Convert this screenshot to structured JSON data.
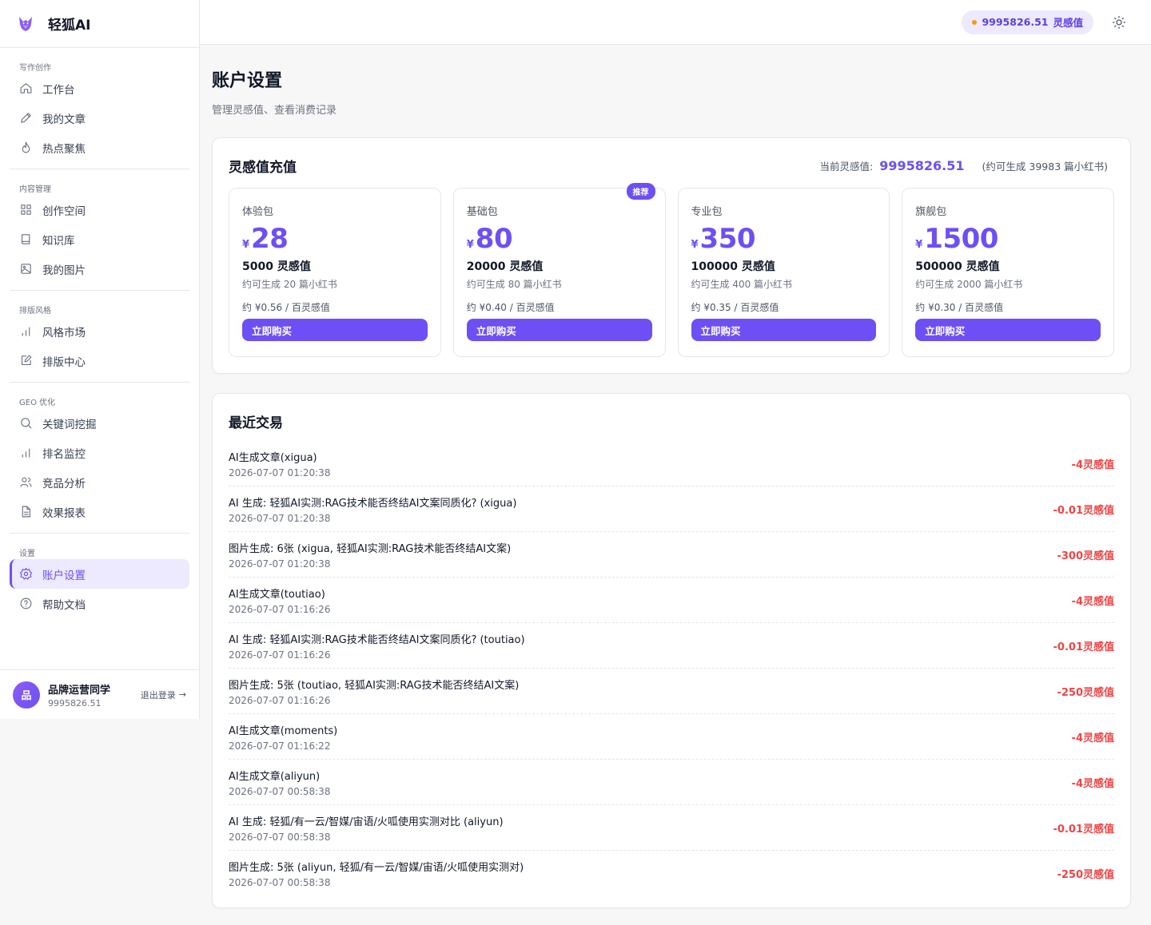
{
  "brand": {
    "name": "轻狐AI"
  },
  "sidebar": {
    "sections": [
      {
        "title": "写作创作",
        "items": [
          {
            "label": "工作台",
            "icon": "home-icon"
          },
          {
            "label": "我的文章",
            "icon": "pen-icon"
          },
          {
            "label": "热点聚焦",
            "icon": "flame-icon"
          }
        ]
      },
      {
        "title": "内容管理",
        "items": [
          {
            "label": "创作空间",
            "icon": "grid-icon"
          },
          {
            "label": "知识库",
            "icon": "book-icon"
          },
          {
            "label": "我的图片",
            "icon": "image-icon"
          }
        ]
      },
      {
        "title": "排版风格",
        "items": [
          {
            "label": "风格市场",
            "icon": "bar-chart-icon"
          },
          {
            "label": "排版中心",
            "icon": "edit-icon"
          }
        ]
      },
      {
        "title": "GEO 优化",
        "items": [
          {
            "label": "关键词挖掘",
            "icon": "search-icon"
          },
          {
            "label": "排名监控",
            "icon": "bar-chart-icon"
          },
          {
            "label": "竞品分析",
            "icon": "users-icon"
          },
          {
            "label": "效果报表",
            "icon": "file-icon"
          }
        ]
      },
      {
        "title": "设置",
        "items": [
          {
            "label": "账户设置",
            "icon": "gear-icon",
            "active": true
          },
          {
            "label": "帮助文档",
            "icon": "help-icon"
          }
        ]
      }
    ]
  },
  "user": {
    "avatar": "品",
    "name": "品牌运营同学",
    "balance": "9995826.51",
    "logout": "退出登录"
  },
  "topbar": {
    "balance": "9995826.51",
    "unit": "灵感值"
  },
  "page": {
    "title": "账户设置",
    "subtitle": "管理灵感值、查看消费记录"
  },
  "recharge": {
    "title": "灵感值充值",
    "current_label": "当前灵感值:",
    "current_value": "9995826.51",
    "estimate": "(约可生成 39983 篇小红书)",
    "packs": [
      {
        "name": "体验包",
        "currency": "¥",
        "price": "28",
        "credits": "5000 灵感值",
        "desc": "约可生成 20 篇小红书",
        "unit": "约 ¥0.56 / 百灵感值",
        "button": "立即购买"
      },
      {
        "name": "基础包",
        "currency": "¥",
        "price": "80",
        "credits": "20000 灵感值",
        "desc": "约可生成 80 篇小红书",
        "unit": "约 ¥0.40 / 百灵感值",
        "button": "立即购买",
        "badge": "推荐"
      },
      {
        "name": "专业包",
        "currency": "¥",
        "price": "350",
        "credits": "100000 灵感值",
        "desc": "约可生成 400 篇小红书",
        "unit": "约 ¥0.35 / 百灵感值",
        "button": "立即购买"
      },
      {
        "name": "旗舰包",
        "currency": "¥",
        "price": "1500",
        "credits": "500000 灵感值",
        "desc": "约可生成 2000 篇小红书",
        "unit": "约 ¥0.30 / 百灵感值",
        "button": "立即购买"
      }
    ]
  },
  "transactions": {
    "title": "最近交易",
    "rows": [
      {
        "desc": "AI生成文章(xigua)",
        "time": "2026-07-07 01:20:38",
        "amount": "-4灵感值"
      },
      {
        "desc": "AI 生成: 轻狐AI实测:RAG技术能否终结AI文案同质化? (xigua)",
        "time": "2026-07-07 01:20:38",
        "amount": "-0.01灵感值"
      },
      {
        "desc": "图片生成: 6张 (xigua, 轻狐AI实测:RAG技术能否终结AI文案)",
        "time": "2026-07-07 01:20:38",
        "amount": "-300灵感值"
      },
      {
        "desc": "AI生成文章(toutiao)",
        "time": "2026-07-07 01:16:26",
        "amount": "-4灵感值"
      },
      {
        "desc": "AI 生成: 轻狐AI实测:RAG技术能否终结AI文案同质化? (toutiao)",
        "time": "2026-07-07 01:16:26",
        "amount": "-0.01灵感值"
      },
      {
        "desc": "图片生成: 5张 (toutiao, 轻狐AI实测:RAG技术能否终结AI文案)",
        "time": "2026-07-07 01:16:26",
        "amount": "-250灵感值"
      },
      {
        "desc": "AI生成文章(moments)",
        "time": "2026-07-07 01:16:22",
        "amount": "-4灵感值"
      },
      {
        "desc": "AI生成文章(aliyun)",
        "time": "2026-07-07 00:58:38",
        "amount": "-4灵感值"
      },
      {
        "desc": "AI 生成: 轻狐/有一云/智媒/宙语/火呱使用实测对比 (aliyun)",
        "time": "2026-07-07 00:58:38",
        "amount": "-0.01灵感值"
      },
      {
        "desc": "图片生成: 5张 (aliyun, 轻狐/有一云/智媒/宙语/火呱使用实测对)",
        "time": "2026-07-07 00:58:38",
        "amount": "-250灵感值"
      }
    ]
  },
  "colors": {
    "accent": "#6d4ff5",
    "negative": "#ef4444",
    "pill_bg": "#ede9fe",
    "dot": "#f59e0b"
  }
}
